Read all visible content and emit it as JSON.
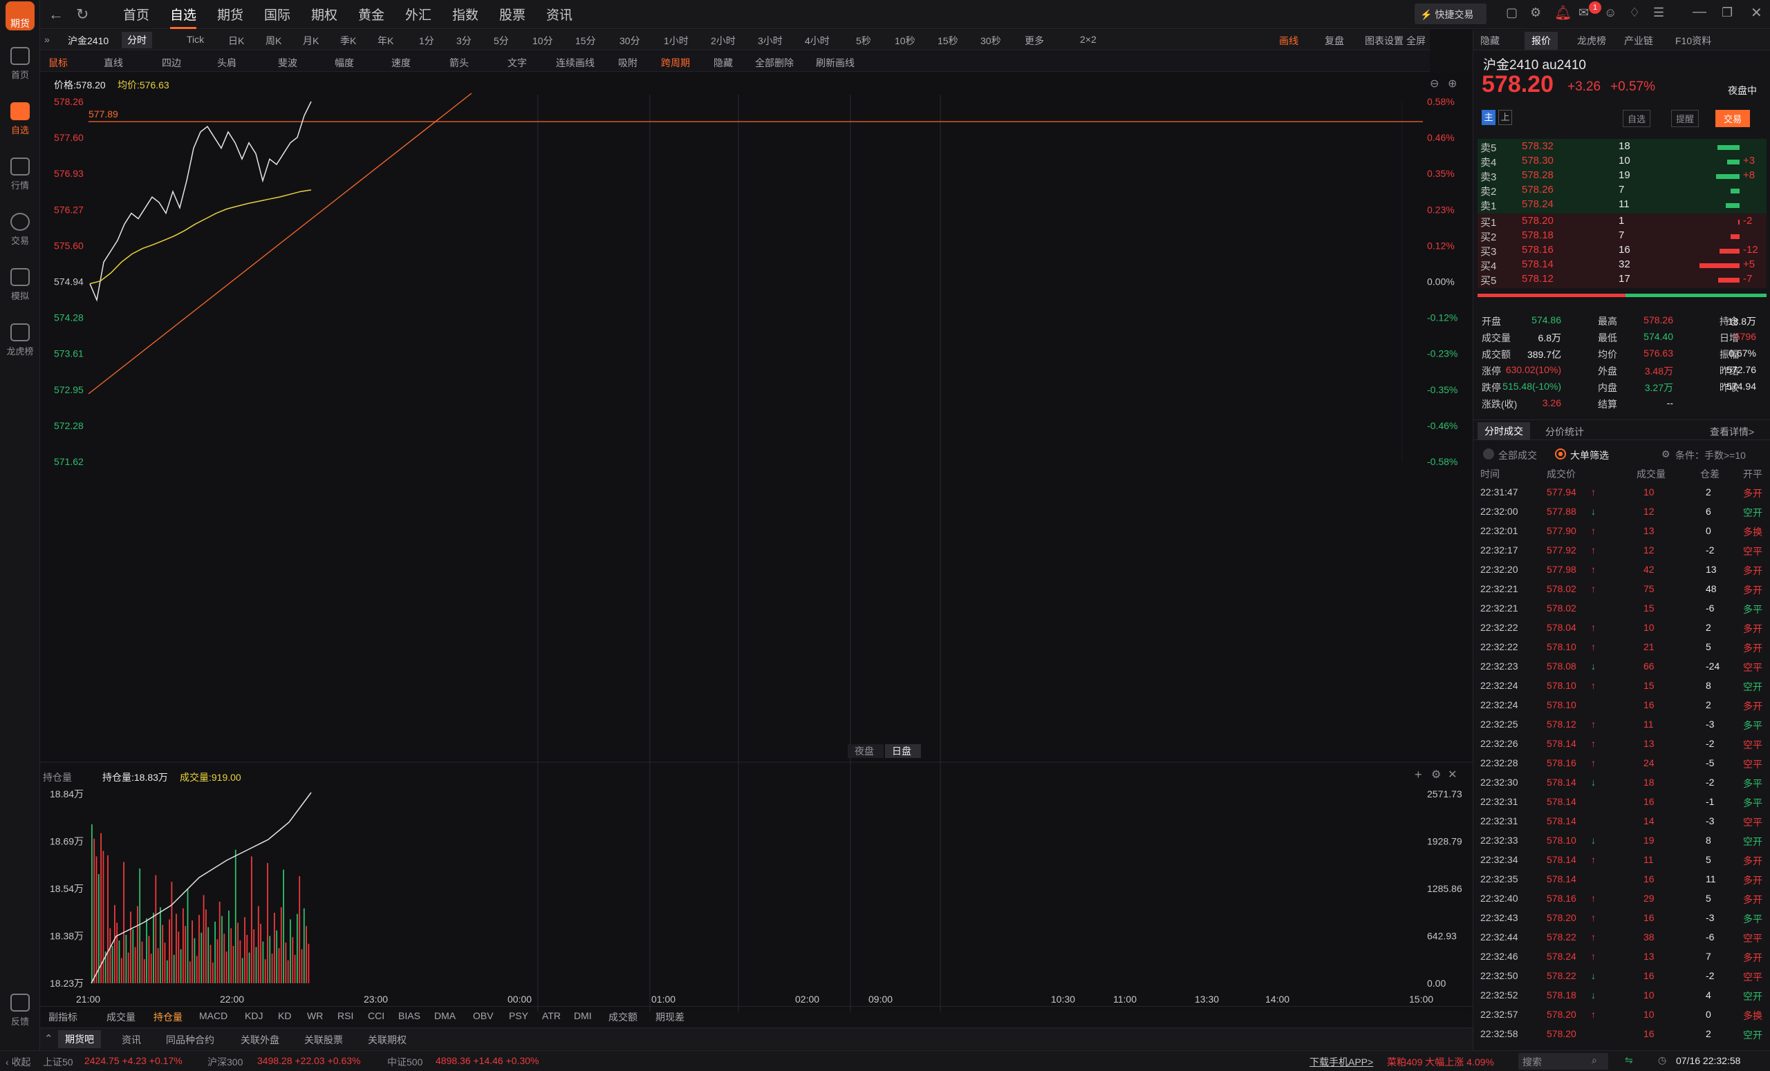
{
  "sidebar": {
    "logo": "期货",
    "items": [
      {
        "label": "首页",
        "icon": "home-icon"
      },
      {
        "label": "自选",
        "icon": "plus-icon"
      },
      {
        "label": "行情",
        "icon": "chart-icon"
      },
      {
        "label": "交易",
        "icon": "yen-icon"
      },
      {
        "label": "模拟",
        "icon": "gamepad-icon"
      },
      {
        "label": "龙虎榜",
        "icon": "database-icon"
      }
    ],
    "feedback": "反馈"
  },
  "topnav": [
    "首页",
    "自选",
    "期货",
    "国际",
    "期权",
    "黄金",
    "外汇",
    "指数",
    "股票",
    "资讯"
  ],
  "quick_trade": "快捷交易",
  "notif_count": "1",
  "toolbar1": {
    "symbol": "沪金2410",
    "periods": [
      "分时",
      "Tick",
      "日K",
      "周K",
      "月K",
      "季K",
      "年K",
      "1分",
      "3分",
      "5分",
      "10分",
      "15分",
      "30分",
      "1小时",
      "2小时",
      "3小时",
      "4小时",
      "5秒",
      "10秒",
      "15秒",
      "30秒",
      "更多",
      "2×2"
    ],
    "right": [
      "画线",
      "复盘",
      "图表设置",
      "全屏"
    ]
  },
  "toolbar2": [
    "鼠标",
    "直线",
    "四边",
    "头肩",
    "斐波",
    "幅度",
    "速度",
    "箭头",
    "文字",
    "连续画线",
    "吸附",
    "跨周期",
    "隐藏",
    "全部删除",
    "刷新画线"
  ],
  "chart_header": {
    "price": "价格:578.20",
    "avg": "均价:576.63"
  },
  "chart_data": {
    "type": "line",
    "price_axis": [
      "578.26",
      "577.60",
      "576.93",
      "576.27",
      "575.60",
      "574.94",
      "574.28",
      "573.61",
      "572.95",
      "572.28",
      "571.62"
    ],
    "pct_axis": [
      "0.58%",
      "0.46%",
      "0.35%",
      "0.23%",
      "0.12%",
      "0.00%",
      "-0.12%",
      "-0.23%",
      "-0.35%",
      "-0.46%",
      "-0.58%"
    ],
    "hline_label": "577.89",
    "session_tabs": [
      "夜盘",
      "日盘"
    ],
    "time_axis": [
      "21:00",
      "22:00",
      "23:00",
      "00:00",
      "01:00",
      "02:00",
      "09:00",
      "10:30",
      "11:00",
      "13:30",
      "14:00",
      "15:00"
    ],
    "price_series": [
      574.9,
      574.6,
      575.3,
      575.5,
      575.7,
      576.0,
      576.2,
      576.1,
      576.3,
      576.5,
      576.4,
      576.2,
      576.6,
      576.3,
      576.8,
      577.4,
      577.7,
      577.8,
      577.6,
      577.4,
      577.7,
      577.5,
      577.2,
      577.5,
      577.3,
      576.8,
      577.2,
      577.1,
      577.3,
      577.5,
      577.6,
      578.0,
      578.26
    ],
    "avg_series": [
      574.9,
      574.95,
      575.1,
      575.3,
      575.45,
      575.55,
      575.62,
      575.7,
      575.78,
      575.88,
      576.0,
      576.1,
      576.2,
      576.28,
      576.33,
      576.38,
      576.42,
      576.46,
      576.5,
      576.55,
      576.6,
      576.63
    ],
    "volume_panel": {
      "label": "持仓量",
      "oi": "持仓量:18.83万",
      "vol": "成交量:919.00",
      "left_axis": [
        "18.84万",
        "18.69万",
        "18.54万",
        "18.38万",
        "18.23万"
      ],
      "right_axis": [
        "2571.73",
        "1928.79",
        "1285.86",
        "642.93",
        "0.00"
      ]
    }
  },
  "indicators": [
    "副指标",
    "成交量",
    "持仓量",
    "MACD",
    "KDJ",
    "KD",
    "WR",
    "RSI",
    "CCI",
    "BIAS",
    "DMA",
    "OBV",
    "PSY",
    "ATR",
    "DMI",
    "成交额",
    "期现差"
  ],
  "bottom_tabs": [
    "期货吧",
    "资讯",
    "同品种合约",
    "关联外盘",
    "关联股票",
    "关联期权"
  ],
  "right": {
    "tabs": [
      "隐藏",
      "报价",
      "龙虎榜",
      "产业链",
      "F10资料"
    ],
    "name": "沪金2410  au2410",
    "price": "578.20",
    "change": "+3.26",
    "pct": "+0.57%",
    "session": "夜盘中",
    "btns": [
      "自选",
      "提醒",
      "交易"
    ],
    "sells": [
      {
        "l": "卖5",
        "p": "578.32",
        "v": "18",
        "d": ""
      },
      {
        "l": "卖4",
        "p": "578.30",
        "v": "10",
        "d": "+3"
      },
      {
        "l": "卖3",
        "p": "578.28",
        "v": "19",
        "d": "+8"
      },
      {
        "l": "卖2",
        "p": "578.26",
        "v": "7",
        "d": ""
      },
      {
        "l": "卖1",
        "p": "578.24",
        "v": "11",
        "d": ""
      }
    ],
    "buys": [
      {
        "l": "买1",
        "p": "578.20",
        "v": "1",
        "d": "-2"
      },
      {
        "l": "买2",
        "p": "578.18",
        "v": "7",
        "d": ""
      },
      {
        "l": "买3",
        "p": "578.16",
        "v": "16",
        "d": "-12"
      },
      {
        "l": "买4",
        "p": "578.14",
        "v": "32",
        "d": "+5"
      },
      {
        "l": "买5",
        "p": "578.12",
        "v": "17",
        "d": "-7"
      }
    ],
    "stats": [
      [
        "开盘",
        "574.86",
        "最高",
        "578.26",
        "持仓",
        "18.8万"
      ],
      [
        "成交量",
        "6.8万",
        "最低",
        "574.40",
        "日增",
        "5796"
      ],
      [
        "成交额",
        "389.7亿",
        "均价",
        "576.63",
        "振幅",
        "0.67%"
      ],
      [
        "涨停",
        "630.02(10%)",
        "外盘",
        "3.48万",
        "昨结",
        "572.76"
      ],
      [
        "跌停",
        "515.48(-10%)",
        "内盘",
        "3.27万",
        "昨收",
        "574.94"
      ],
      [
        "涨跌(收)",
        "3.26",
        "结算",
        "--",
        "",
        ""
      ]
    ],
    "trade_tabs": [
      "分时成交",
      "分价统计",
      "查看详情>"
    ],
    "filter": [
      "全部成交",
      "大单筛选",
      "条件：手数>=10"
    ],
    "trade_head": [
      "时间",
      "成交价",
      "成交量",
      "仓差",
      "开平"
    ],
    "trades": [
      [
        "22:31:47",
        "577.94",
        "↑",
        "10",
        "2",
        "多开"
      ],
      [
        "22:32:00",
        "577.88",
        "↓",
        "12",
        "6",
        "空开"
      ],
      [
        "22:32:01",
        "577.90",
        "↑",
        "13",
        "0",
        "多换"
      ],
      [
        "22:32:17",
        "577.92",
        "↑",
        "12",
        "-2",
        "空平"
      ],
      [
        "22:32:20",
        "577.98",
        "↑",
        "42",
        "13",
        "多开"
      ],
      [
        "22:32:21",
        "578.02",
        "↑",
        "75",
        "48",
        "多开"
      ],
      [
        "22:32:21",
        "578.02",
        "",
        "15",
        "-6",
        "多平"
      ],
      [
        "22:32:22",
        "578.04",
        "↑",
        "10",
        "2",
        "多开"
      ],
      [
        "22:32:22",
        "578.10",
        "↑",
        "21",
        "5",
        "多开"
      ],
      [
        "22:32:23",
        "578.08",
        "↓",
        "66",
        "-24",
        "空平"
      ],
      [
        "22:32:24",
        "578.10",
        "↑",
        "15",
        "8",
        "空开"
      ],
      [
        "22:32:24",
        "578.10",
        "",
        "16",
        "2",
        "多开"
      ],
      [
        "22:32:25",
        "578.12",
        "↑",
        "11",
        "-3",
        "多平"
      ],
      [
        "22:32:26",
        "578.14",
        "↑",
        "13",
        "-2",
        "空平"
      ],
      [
        "22:32:28",
        "578.16",
        "↑",
        "24",
        "-5",
        "空平"
      ],
      [
        "22:32:30",
        "578.14",
        "↓",
        "18",
        "-2",
        "多平"
      ],
      [
        "22:32:31",
        "578.14",
        "",
        "16",
        "-1",
        "多平"
      ],
      [
        "22:32:31",
        "578.14",
        "",
        "14",
        "-3",
        "空平"
      ],
      [
        "22:32:33",
        "578.10",
        "↓",
        "19",
        "8",
        "空开"
      ],
      [
        "22:32:34",
        "578.14",
        "↑",
        "11",
        "5",
        "多开"
      ],
      [
        "22:32:35",
        "578.14",
        "",
        "16",
        "11",
        "多开"
      ],
      [
        "22:32:40",
        "578.16",
        "↑",
        "29",
        "5",
        "多开"
      ],
      [
        "22:32:43",
        "578.20",
        "↑",
        "16",
        "-3",
        "多平"
      ],
      [
        "22:32:44",
        "578.22",
        "↑",
        "38",
        "-6",
        "空平"
      ],
      [
        "22:32:46",
        "578.24",
        "↑",
        "13",
        "7",
        "多开"
      ],
      [
        "22:32:50",
        "578.22",
        "↓",
        "16",
        "-2",
        "空平"
      ],
      [
        "22:32:52",
        "578.18",
        "↓",
        "10",
        "4",
        "空开"
      ],
      [
        "22:32:57",
        "578.20",
        "↑",
        "10",
        "0",
        "多换"
      ],
      [
        "22:32:58",
        "578.20",
        "",
        "16",
        "2",
        "空开"
      ]
    ]
  },
  "bottombar": {
    "collapse": "收起",
    "indices": [
      {
        "n": "上证50",
        "v": "2424.75 +4.23 +0.17%"
      },
      {
        "n": "沪深300",
        "v": "3498.28 +22.03 +0.63%"
      },
      {
        "n": "中证500",
        "v": "4898.36 +14.46 +0.30%"
      }
    ],
    "app": "下载手机APP>",
    "news": "菜粕409 大幅上涨 4.09%",
    "search": "搜索",
    "datetime": "07/16 22:32:58"
  }
}
